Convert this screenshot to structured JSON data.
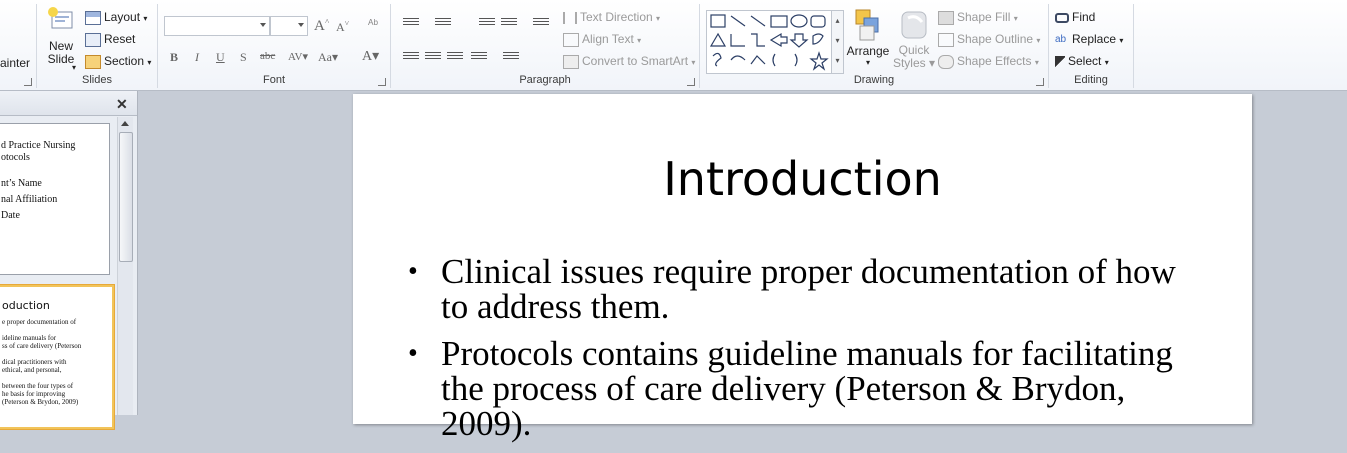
{
  "ribbon": {
    "clipboard": {
      "format_painter_label": "ainter"
    },
    "slides": {
      "group_label": "Slides",
      "new_slide_label_1": "New",
      "new_slide_label_2": "Slide",
      "layout_label": "Layout",
      "reset_label": "Reset",
      "section_label": "Section"
    },
    "font": {
      "group_label": "Font",
      "font_name_value": "",
      "font_size_value": ""
    },
    "paragraph": {
      "group_label": "Paragraph",
      "text_direction_label": "Text Direction",
      "align_text_label": "Align Text",
      "smartart_label": "Convert to SmartArt"
    },
    "drawing": {
      "group_label": "Drawing",
      "arrange_label": "Arrange",
      "quick_styles_label_1": "Quick",
      "quick_styles_label_2": "Styles",
      "shape_fill_label": "Shape Fill",
      "shape_outline_label": "Shape Outline",
      "shape_effects_label": "Shape Effects"
    },
    "editing": {
      "group_label": "Editing",
      "find_label": "Find",
      "replace_label": "Replace",
      "select_label": "Select"
    }
  },
  "slides_panel": {
    "slide1_lines": [
      "d Practice Nursing",
      "otocols",
      "",
      "nt’s Name",
      "nal Affiliation",
      "Date"
    ],
    "slide2_title": "oduction",
    "slide2_lines": [
      "e proper documentation of",
      "",
      "ideline  manuals for",
      "ss of care delivery (Peterson",
      "",
      "dical practitioners with",
      "ethical, and personal,",
      "",
      "between the four types of",
      "he basis for improving",
      "(Peterson & Brydon, 2009)"
    ]
  },
  "slide": {
    "title": "Introduction",
    "bullets": [
      "Clinical issues require proper documentation of how to address them.",
      "Protocols contains guideline manuals for facilitating the process of care delivery (Peterson & Brydon, 2009)."
    ]
  },
  "colors": {
    "accent": "#f2c45a",
    "ribbon_bg": "#f1f4f9",
    "workspace_bg": "#c6ccd6"
  }
}
